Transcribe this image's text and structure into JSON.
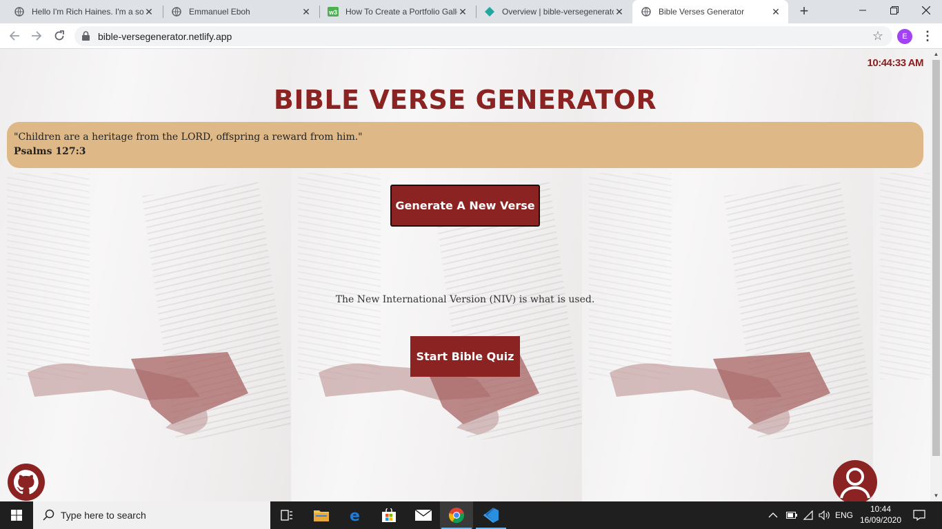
{
  "browser": {
    "tabs": [
      {
        "title": "Hello I'm Rich Haines. I'm a sof",
        "favicon": "globe-icon"
      },
      {
        "title": "Emmanuel Eboh",
        "favicon": "globe-icon"
      },
      {
        "title": "How To Create a Portfolio Galle",
        "favicon": "w3schools-icon"
      },
      {
        "title": "Overview | bible-versegenerato",
        "favicon": "netlify-icon"
      },
      {
        "title": "Bible Verses Generator",
        "favicon": "globe-icon"
      }
    ],
    "active_tab": 4,
    "url": "bible-versegenerator.netlify.app",
    "profile_initial": "E"
  },
  "page": {
    "clock": "10:44:33 AM",
    "title": "BIBLE VERSE GENERATOR",
    "verse": {
      "text": "\"Children are a heritage from the LORD, offspring a reward from him.\"",
      "reference": "Psalms 127:3"
    },
    "generate_button": "Generate A New Verse",
    "version_note": "The New International Version (NIV) is what is used.",
    "quiz_button": "Start Bible Quiz",
    "accent_color": "#8b2323",
    "card_color": "#deb887"
  },
  "taskbar": {
    "search_placeholder": "Type here to search",
    "language": "ENG",
    "time": "10:44",
    "date": "16/09/2020",
    "pinned": [
      "task-view-icon",
      "file-explorer-icon",
      "edge-icon",
      "store-icon",
      "mail-icon",
      "chrome-icon",
      "vscode-icon"
    ]
  }
}
